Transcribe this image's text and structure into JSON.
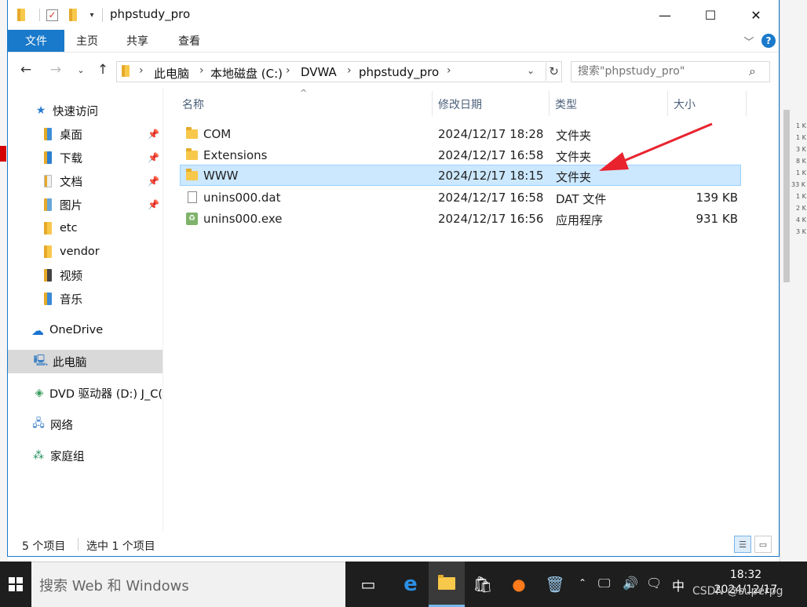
{
  "window": {
    "title": "phpstudy_pro",
    "minimize": "—",
    "maximize": "☐",
    "close": "✕"
  },
  "ribbon": {
    "file_tab": "文件",
    "tabs": [
      "主页",
      "共享",
      "查看"
    ],
    "help": "?"
  },
  "address": {
    "crumbs": [
      "此电脑",
      "本地磁盘 (C:)",
      "DVWA",
      "phpstudy_pro"
    ],
    "search_placeholder": "搜索\"phpstudy_pro\""
  },
  "nav": {
    "items": [
      {
        "label": "快速访问",
        "icon": "star-icon"
      },
      {
        "label": "桌面",
        "icon": "desktop-folder-icon",
        "pinned": true
      },
      {
        "label": "下载",
        "icon": "download-folder-icon",
        "pinned": true
      },
      {
        "label": "文档",
        "icon": "documents-folder-icon",
        "pinned": true
      },
      {
        "label": "图片",
        "icon": "pictures-folder-icon",
        "pinned": true
      },
      {
        "label": "etc",
        "icon": "folder-icon"
      },
      {
        "label": "vendor",
        "icon": "folder-icon"
      },
      {
        "label": "视频",
        "icon": "videos-folder-icon"
      },
      {
        "label": "音乐",
        "icon": "music-folder-icon"
      },
      {
        "label": "OneDrive",
        "icon": "cloud-icon"
      },
      {
        "label": "此电脑",
        "icon": "computer-icon",
        "selected": true
      },
      {
        "label": "DVD 驱动器 (D:) J_C(",
        "icon": "dvd-icon"
      },
      {
        "label": "网络",
        "icon": "network-icon"
      },
      {
        "label": "家庭组",
        "icon": "homegroup-icon"
      }
    ]
  },
  "columns": {
    "name": "名称",
    "modified": "修改日期",
    "type": "类型",
    "size": "大小"
  },
  "files": [
    {
      "name": "COM",
      "modified": "2024/12/17 18:28",
      "type": "文件夹",
      "size": "",
      "icon": "folder-icon"
    },
    {
      "name": "Extensions",
      "modified": "2024/12/17 16:58",
      "type": "文件夹",
      "size": "",
      "icon": "folder-icon"
    },
    {
      "name": "WWW",
      "modified": "2024/12/17 18:15",
      "type": "文件夹",
      "size": "",
      "icon": "folder-icon",
      "selected": true
    },
    {
      "name": "unins000.dat",
      "modified": "2024/12/17 16:58",
      "type": "DAT 文件",
      "size": "139 KB",
      "icon": "file-icon"
    },
    {
      "name": "unins000.exe",
      "modified": "2024/12/17 16:56",
      "type": "应用程序",
      "size": "931 KB",
      "icon": "exe-icon"
    }
  ],
  "status": {
    "count": "5 个项目",
    "selected": "选中 1 个项目"
  },
  "taskbar": {
    "search_text": "搜索 Web 和 Windows",
    "time": "18:32",
    "date": "2024/12/17",
    "ime": "中",
    "watermark": "CSDN @superpg"
  },
  "background": {
    "sizes": [
      "1 K",
      "1 K",
      "3 K",
      "8 K",
      "1 K",
      "33 K",
      "1 K",
      "2 K",
      "4 K",
      "3 K"
    ]
  },
  "colors": {
    "accent": "#1979ca",
    "selection": "#cce8ff",
    "annotation_arrow": "#e8232e"
  }
}
